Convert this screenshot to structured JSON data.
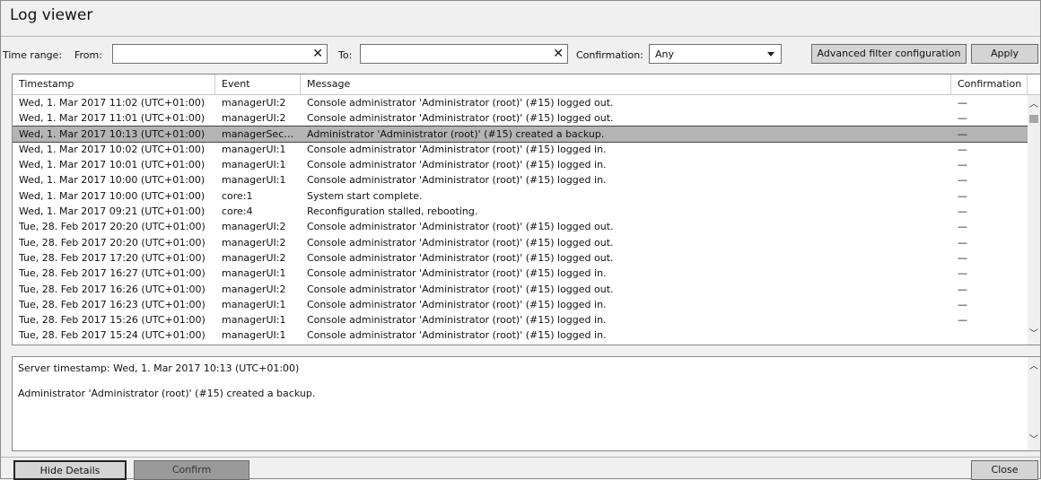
{
  "window": {
    "title": "Log viewer"
  },
  "filter": {
    "time_range_label": "Time range:",
    "from_label": "From:",
    "from_value": "",
    "to_label": "To:",
    "to_value": "",
    "clear_glyph": "✕",
    "confirmation_label": "Confirmation:",
    "confirmation_value": "Any",
    "advanced_button": "Advanced filter configuration",
    "apply_button": "Apply"
  },
  "table": {
    "columns": [
      "Timestamp",
      "Event",
      "Message",
      "Confirmation"
    ],
    "rows": [
      {
        "timestamp": "Wed, 1. Mar 2017 11:02 (UTC+01:00)",
        "event": "managerUI:2",
        "message": "Console administrator 'Administrator (root)' (#15) logged out.",
        "confirmation": "—",
        "selected": false
      },
      {
        "timestamp": "Wed, 1. Mar 2017 11:01 (UTC+01:00)",
        "event": "managerUI:2",
        "message": "Console administrator 'Administrator (root)' (#15) logged out.",
        "confirmation": "—",
        "selected": false
      },
      {
        "timestamp": "Wed, 1. Mar 2017 10:13 (UTC+01:00)",
        "event": "managerSecur...",
        "message": "Administrator 'Administrator (root)' (#15) created a backup.",
        "confirmation": "—",
        "selected": true
      },
      {
        "timestamp": "Wed, 1. Mar 2017 10:02 (UTC+01:00)",
        "event": "managerUI:1",
        "message": "Console administrator 'Administrator (root)' (#15) logged in.",
        "confirmation": "—",
        "selected": false
      },
      {
        "timestamp": "Wed, 1. Mar 2017 10:01 (UTC+01:00)",
        "event": "managerUI:1",
        "message": "Console administrator 'Administrator (root)' (#15) logged in.",
        "confirmation": "—",
        "selected": false
      },
      {
        "timestamp": "Wed, 1. Mar 2017 10:00 (UTC+01:00)",
        "event": "managerUI:1",
        "message": "Console administrator 'Administrator (root)' (#15) logged in.",
        "confirmation": "—",
        "selected": false
      },
      {
        "timestamp": "Wed, 1. Mar 2017 10:00 (UTC+01:00)",
        "event": "core:1",
        "message": "System start complete.",
        "confirmation": "—",
        "selected": false
      },
      {
        "timestamp": "Wed, 1. Mar 2017 09:21 (UTC+01:00)",
        "event": "core:4",
        "message": "Reconfiguration stalled, rebooting.",
        "confirmation": "—",
        "selected": false
      },
      {
        "timestamp": "Tue, 28. Feb 2017 20:20 (UTC+01:00)",
        "event": "managerUI:2",
        "message": "Console administrator 'Administrator (root)' (#15) logged out.",
        "confirmation": "—",
        "selected": false
      },
      {
        "timestamp": "Tue, 28. Feb 2017 20:20 (UTC+01:00)",
        "event": "managerUI:2",
        "message": "Console administrator 'Administrator (root)' (#15) logged out.",
        "confirmation": "—",
        "selected": false
      },
      {
        "timestamp": "Tue, 28. Feb 2017 17:20 (UTC+01:00)",
        "event": "managerUI:2",
        "message": "Console administrator 'Administrator (root)' (#15) logged out.",
        "confirmation": "—",
        "selected": false
      },
      {
        "timestamp": "Tue, 28. Feb 2017 16:27 (UTC+01:00)",
        "event": "managerUI:1",
        "message": "Console administrator 'Administrator (root)' (#15) logged in.",
        "confirmation": "—",
        "selected": false
      },
      {
        "timestamp": "Tue, 28. Feb 2017 16:26 (UTC+01:00)",
        "event": "managerUI:2",
        "message": "Console administrator 'Administrator (root)' (#15) logged out.",
        "confirmation": "—",
        "selected": false
      },
      {
        "timestamp": "Tue, 28. Feb 2017 16:23 (UTC+01:00)",
        "event": "managerUI:1",
        "message": "Console administrator 'Administrator (root)' (#15) logged in.",
        "confirmation": "—",
        "selected": false
      },
      {
        "timestamp": "Tue, 28. Feb 2017 15:26 (UTC+01:00)",
        "event": "managerUI:1",
        "message": "Console administrator 'Administrator (root)' (#15) logged in.",
        "confirmation": "—",
        "selected": false
      },
      {
        "timestamp": "Tue, 28. Feb 2017 15:24 (UTC+01:00)",
        "event": "managerUI:1",
        "message": "Console administrator 'Administrator (root)' (#15) logged in.",
        "confirmation": "",
        "selected": false
      }
    ]
  },
  "details": {
    "server_timestamp": "Server timestamp: Wed, 1. Mar 2017 10:13 (UTC+01:00)",
    "message": "Administrator 'Administrator (root)' (#15) created a backup."
  },
  "bottom": {
    "hide_details_button": "Hide Details",
    "confirm_button": "Confirm",
    "close_button": "Close"
  },
  "icons": {
    "scroll_up": "scroll-up-icon",
    "scroll_down": "scroll-down-icon",
    "dropdown": "chevron-down-icon",
    "clear": "clear-icon"
  }
}
